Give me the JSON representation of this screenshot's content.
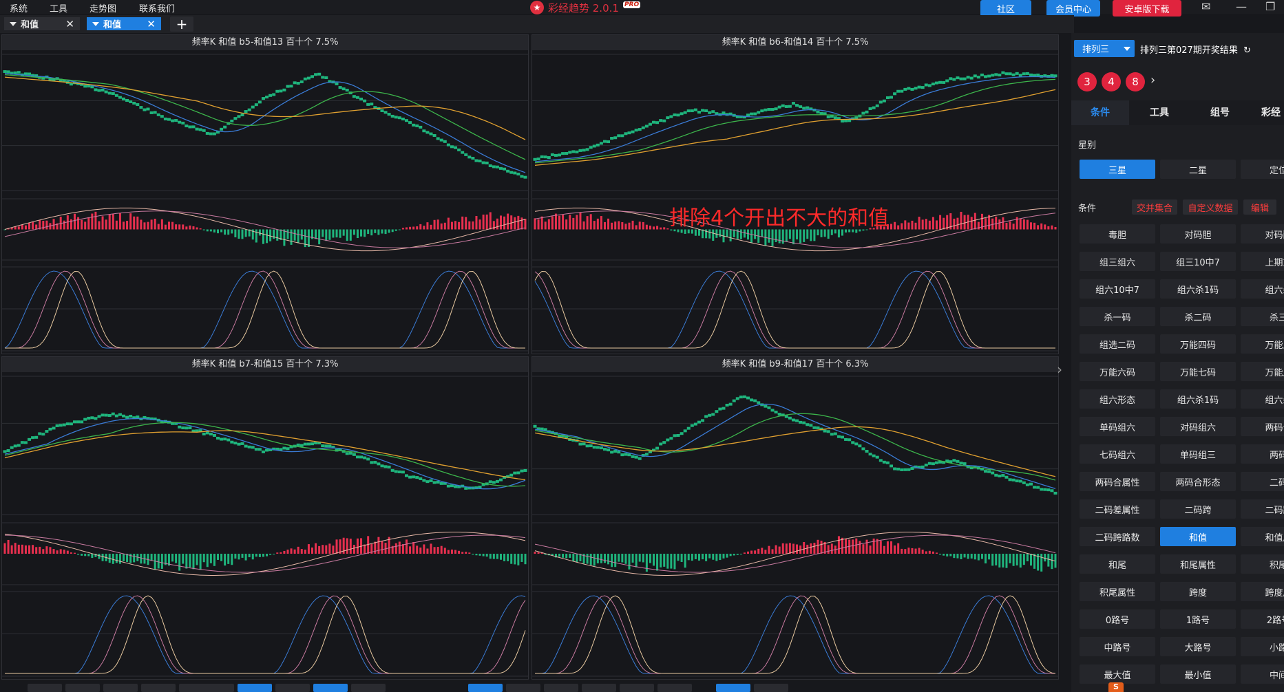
{
  "menu": [
    "系统",
    "工具",
    "走势图",
    "联系我们"
  ],
  "app": {
    "name": "彩经趋势 2.0.1",
    "badge": "PRO"
  },
  "header_buttons": [
    {
      "label": "社区",
      "color": "#1f7fe0"
    },
    {
      "label": "会员中心",
      "color": "#1f7fe0"
    },
    {
      "label": "安卓版下载",
      "color": "#e0243e"
    }
  ],
  "window_icons": [
    "mail-icon",
    "minimize-icon",
    "restore-icon"
  ],
  "tabs": [
    {
      "label": "和值",
      "active": false
    },
    {
      "label": "和值",
      "active": true
    }
  ],
  "panels": [
    {
      "title": "频率K  和值  b5-和值13  百十个  7.5%"
    },
    {
      "title": "频率K  和值  b6-和值14  百十个  7.5%"
    },
    {
      "title": "频率K  和值  b7-和值15  百十个  7.3%"
    },
    {
      "title": "频率K  和值  b9-和值17  百十个  6.3%"
    }
  ],
  "annotation": "排除4个开出不大的和值",
  "colors": {
    "up": "#e8304f",
    "down": "#1fb57d",
    "ma_blue": "#3a7bd5",
    "ma_green": "#3cb44b",
    "ma_orange": "#e0a030",
    "accent": "#1f7fe0"
  },
  "sidebar": {
    "lottery": "排列三",
    "draw_title": "排列三第027期开奖结果",
    "balls": [
      "3",
      "4",
      "8"
    ],
    "tabs": [
      {
        "label": "条件",
        "active": true
      },
      {
        "label": "工具",
        "active": false
      },
      {
        "label": "组号",
        "active": false
      },
      {
        "label": "彩经",
        "active": false
      }
    ],
    "star_label": "星别",
    "stars": [
      {
        "label": "三星",
        "active": true
      },
      {
        "label": "二星",
        "active": false
      },
      {
        "label": "定位",
        "active": false
      }
    ],
    "cond_label": "条件",
    "chips": [
      "交并集合",
      "自定义数据",
      "编辑"
    ],
    "conditions": [
      [
        "毒胆",
        "对码胆",
        "对码配"
      ],
      [
        "组三组六",
        "组三10中7",
        "上期重"
      ],
      [
        "组六10中7",
        "组六杀1码",
        "组六杀"
      ],
      [
        "杀一码",
        "杀二码",
        "杀三"
      ],
      [
        "组选二码",
        "万能四码",
        "万能五"
      ],
      [
        "万能六码",
        "万能七码",
        "万能八"
      ],
      [
        "组六形态",
        "组六杀1码",
        "组六杀"
      ],
      [
        "单码组六",
        "对码组六",
        "两码合"
      ],
      [
        "七码组六",
        "单码组三",
        "两码"
      ],
      [
        "两码合属性",
        "两码合形态",
        "二码"
      ],
      [
        "二码差属性",
        "二码跨",
        "二码跨"
      ],
      [
        "二码跨路数",
        "和值",
        "和值属"
      ],
      [
        "和尾",
        "和尾属性",
        "积尾"
      ],
      [
        "积尾属性",
        "跨度",
        "跨度属"
      ],
      [
        "0路号",
        "1路号",
        "2路号"
      ],
      [
        "中路号",
        "大路号",
        "小路"
      ],
      [
        "最大值",
        "最小值",
        "中间"
      ]
    ],
    "active_condition": "和值"
  }
}
